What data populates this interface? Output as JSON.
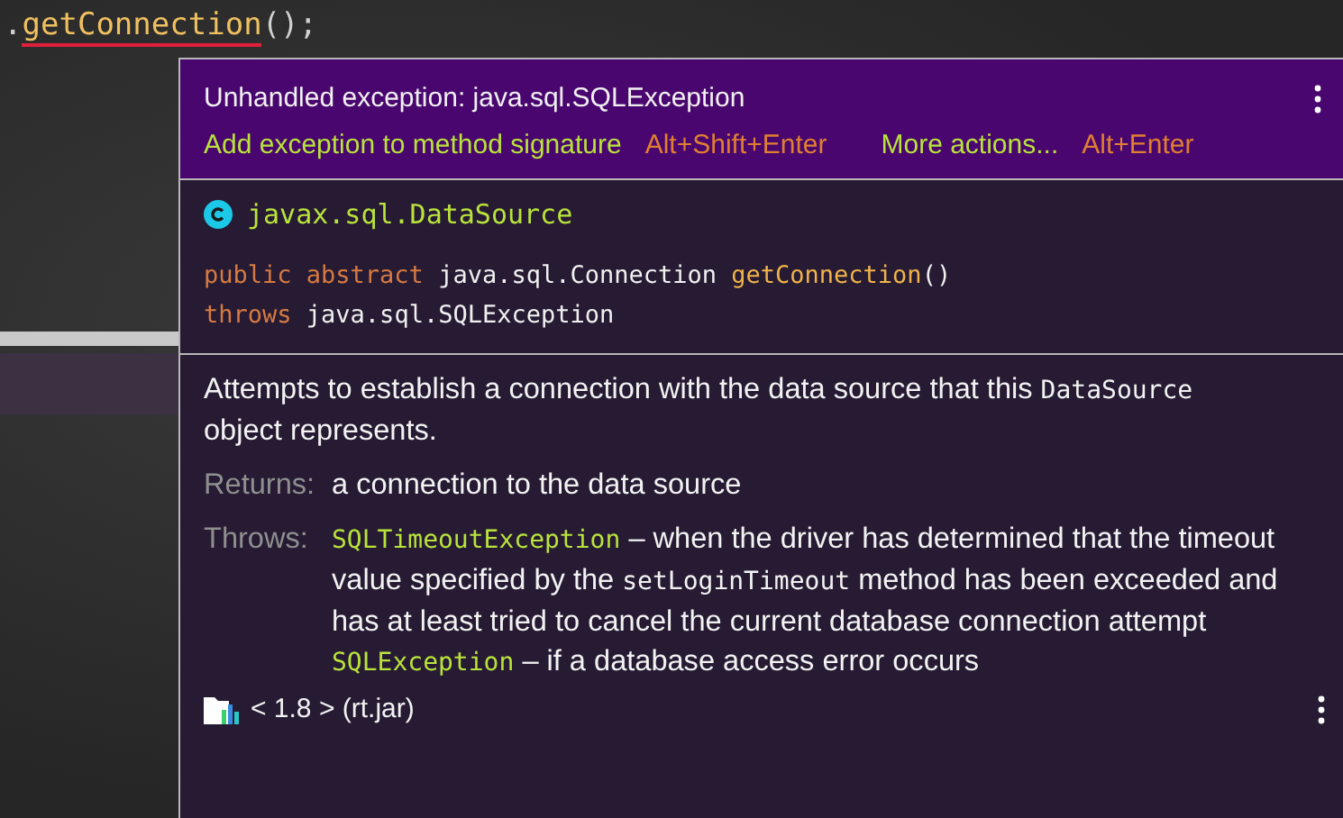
{
  "editor": {
    "code_line": [
      {
        "text": ".",
        "kind": "plain"
      },
      {
        "text": "getConnection",
        "kind": "error"
      },
      {
        "text": "();",
        "kind": "plain"
      }
    ]
  },
  "popup": {
    "problem": "Unhandled exception: java.sql.SQLException",
    "actions": [
      {
        "label": "Add exception to method signature",
        "shortcut": "Alt+Shift+Enter"
      },
      {
        "label": "More actions...",
        "shortcut": "Alt+Enter"
      }
    ],
    "class_name": "javax.sql.DataSource",
    "signature": [
      [
        {
          "text": "public abstract",
          "kind": "keyword"
        },
        {
          "text": "java.sql.Connection",
          "kind": "type"
        },
        {
          "text": "getConnection",
          "kind": "method"
        },
        {
          "text": "()",
          "kind": "attached"
        }
      ],
      [
        {
          "text": "throws",
          "kind": "keyword"
        },
        {
          "text": "java.sql.SQLException",
          "kind": "type"
        }
      ]
    ],
    "description": [
      {
        "text": "Attempts to establish a connection with the data source that this",
        "kind": "text"
      },
      {
        "text": "DataSource",
        "kind": "code"
      },
      {
        "text": "object represents.",
        "kind": "text"
      }
    ],
    "returns": {
      "label": "Returns:",
      "text": "a connection to the data source"
    },
    "throws": {
      "label": "Throws:",
      "entries": [
        [
          {
            "text": "SQLTimeoutException",
            "kind": "link"
          },
          {
            "text": "– when the driver has determined that the timeout value specified by the",
            "kind": "text"
          },
          {
            "text": "setLoginTimeout",
            "kind": "code"
          },
          {
            "text": "method has been exceeded and has at least tried to cancel the current database connection attempt",
            "kind": "text"
          }
        ],
        [
          {
            "text": "SQLException",
            "kind": "link"
          },
          {
            "text": "– if a database access error occurs",
            "kind": "text"
          }
        ]
      ]
    },
    "library": "< 1.8 > (rt.jar)"
  }
}
